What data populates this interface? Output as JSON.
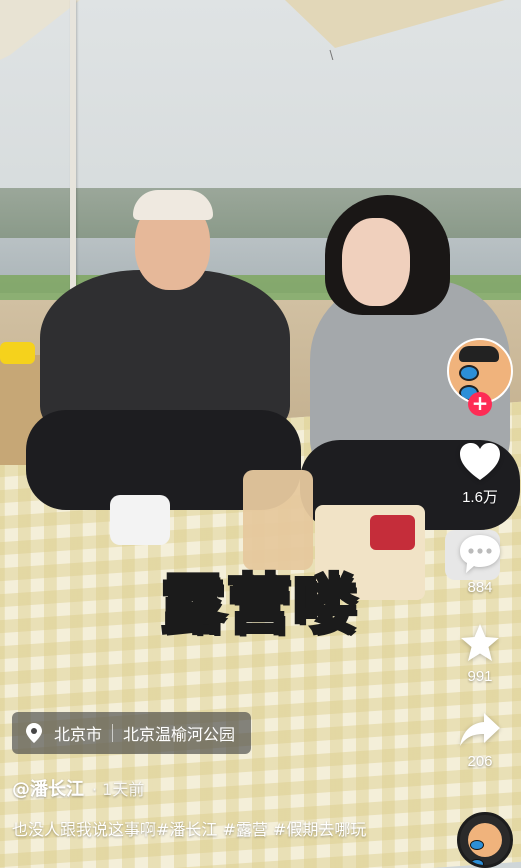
{
  "sticker": {
    "text": "露营喽",
    "color": "#b7dc46"
  },
  "sidebar": {
    "follow_plus": "+",
    "like_count": "1.6万",
    "comment_count": "884",
    "favorite_count": "991",
    "share_count": "206",
    "icons": [
      "author-avatar",
      "heart-icon",
      "comment-icon",
      "star-icon",
      "share-icon"
    ]
  },
  "location": {
    "city": "北京市",
    "place": "北京温榆河公园"
  },
  "post": {
    "username": "@潘长江",
    "time": "1天前",
    "caption": "也没人跟我说这事啊#潘长江 #露营 #假期去哪玩"
  },
  "colors": {
    "follow": "#fe2c55",
    "sticker_text": "#b7dc46"
  }
}
